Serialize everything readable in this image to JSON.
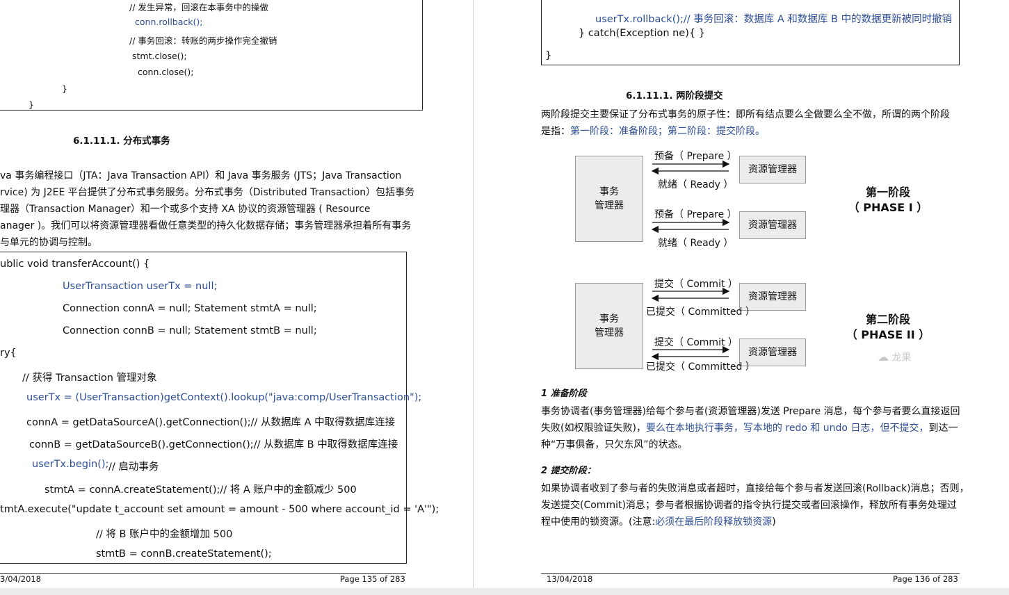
{
  "left_page": {
    "top_code": [
      "// 发生异常，回滚在本事务中的操做",
      "conn.rollback();",
      "// 事务回滚：转账的两步操作完全撤销",
      "stmt.close();",
      "conn.close();",
      "}",
      "}"
    ],
    "heading": "6.1.11.1.   分布式事务",
    "paragraph": [
      "va 事务编程接口（JTA：Java Transaction API）和 Java 事务服务 (JTS；Java Transaction",
      "rvice) 为 J2EE 平台提供了分布式事务服务。分布式事务（Distributed Transaction）包括事务",
      "理器（Transaction Manager）和一个或多个支持 XA 协议的资源管理器 ( Resource",
      "anager )。我们可以将资源管理器看做任意类型的持久化数据存储；事务管理器承担着所有事务",
      "与单元的协调与控制。"
    ],
    "code": [
      "ublic void transferAccount() {",
      "UserTransaction userTx = null;",
      "Connection connA = null; Statement stmtA = null;",
      "Connection connB = null; Statement stmtB = null;",
      "ry{",
      "// 获得 Transaction 管理对象",
      "userTx = (UserTransaction)getContext().lookup(\"java:comp/UserTransaction\");",
      "connA = getDataSourceA().getConnection();// 从数据库 A 中取得数据库连接",
      "connB = getDataSourceB().getConnection();// 从数据库 B 中取得数据库连接",
      "userTx.begin();",
      "// 启动事务",
      "stmtA = connA.createStatement();// 将 A 账户中的金额减少 500",
      "tmtA.execute(\"update t_account set amount = amount - 500 where account_id = 'A'\");",
      "// 将 B 账户中的金额增加 500",
      "stmtB = connB.createStatement();"
    ],
    "footer_date": "3/04/2018",
    "footer_page": "Page 135 of 283"
  },
  "right_page": {
    "top_code": [
      "userTx.rollback();// 事务回滚：数据库 A 和数据库 B 中的数据更新被同时撤销",
      "} catch(Exception ne){ }",
      "}"
    ],
    "heading": "6.1.11.1.   两阶段提交",
    "intro_1": "两阶段提交主要保证了分布式事务的原子性：即所有结点要么全做要么全不做，所谓的两个阶段",
    "intro_2_prefix": "是指：",
    "intro_2_link": "第一阶段：准备阶段；第二阶段：提交阶段。",
    "diagram": {
      "tm_label_1": "事务",
      "tm_label_2": "管理器",
      "rm_label": "资源管理器",
      "prepare": "预备（ Prepare ）",
      "ready": "就绪（ Ready ）",
      "commit": "提交（ Commit ）",
      "committed": "已提交（ Committed ）",
      "phase1_title": "第一阶段",
      "phase1_sub": "（ PHASE I ）",
      "phase2_title": "第二阶段",
      "phase2_sub": "（ PHASE II ）",
      "watermark": "龙果"
    },
    "sec1_title": "1 准备阶段",
    "sec1_l1": "事务协调者(事务管理器)给每个参与者(资源管理器)发送 Prepare 消息，每个参与者要么直接返回",
    "sec1_l2_prefix": "失败(如权限验证失败)，",
    "sec1_l2_link": "要么在本地执行事务，写本地的 redo 和 undo 日志，但不提交，",
    "sec1_l2_suffix": "到达一",
    "sec1_l3": "种“万事俱备，只欠东风”的状态。",
    "sec2_title": "2 提交阶段：",
    "sec2_l1": "如果协调者收到了参与者的失败消息或者超时，直接给每个参与者发送回滚(Rollback)消息；否则，",
    "sec2_l2": "发送提交(Commit)消息；参与者根据协调者的指令执行提交或者回滚操作，释放所有事务处理过",
    "sec2_l3_prefix": "程中使用的锁资源。(注意:",
    "sec2_l3_link": "必须在最后阶段释放锁资源",
    "sec2_l3_suffix": ")",
    "footer_date": "13/04/2018",
    "footer_page": "Page 136 of 283"
  },
  "colors": {
    "link_blue": "#2e4e96",
    "box_fill": "#ececec"
  }
}
